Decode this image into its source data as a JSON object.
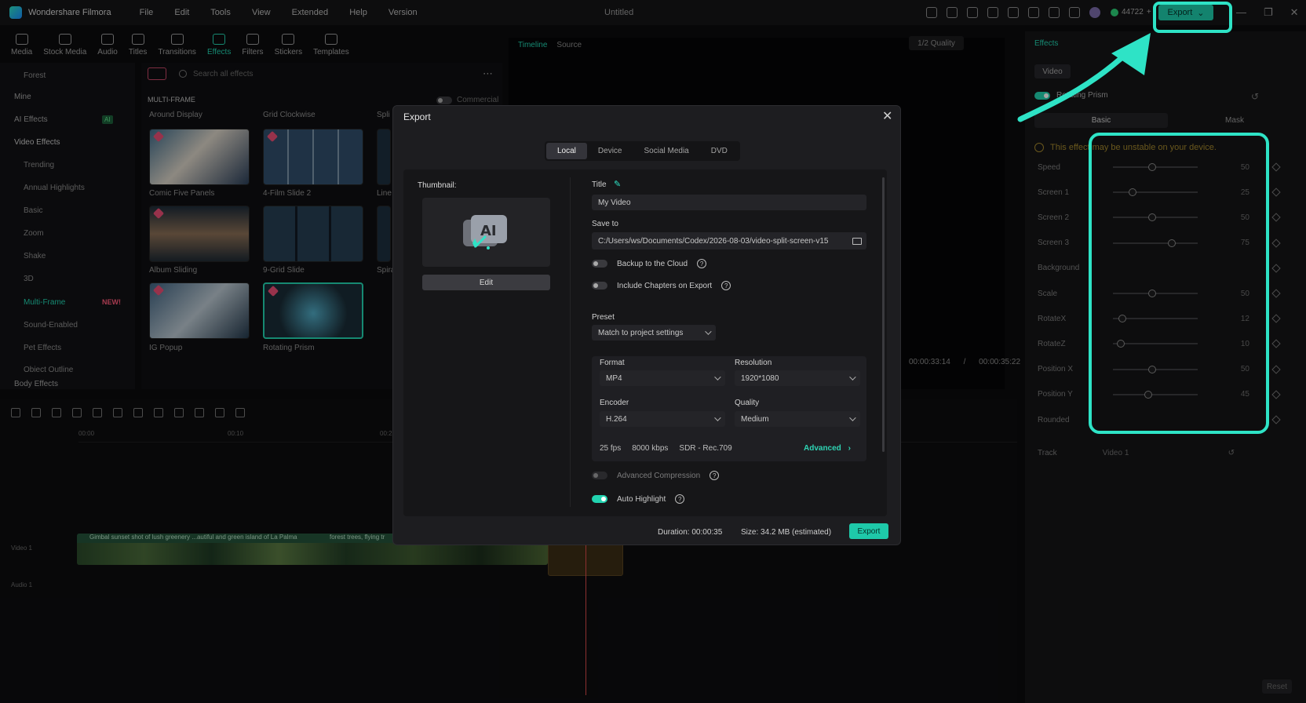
{
  "app": {
    "name": "Wondershare Filmora",
    "menu": [
      "File",
      "Edit",
      "Tools",
      "View",
      "Extended",
      "Help",
      "Version"
    ],
    "document_title": "Untitled",
    "credits": "44722",
    "export_label": "Export",
    "window_controls": [
      "—",
      "❐",
      "✕"
    ]
  },
  "toolbar": {
    "items": [
      {
        "label": "Media",
        "icon": "media-icon"
      },
      {
        "label": "Stock Media",
        "icon": "stock-media-icon"
      },
      {
        "label": "Audio",
        "icon": "audio-icon"
      },
      {
        "label": "Titles",
        "icon": "titles-icon"
      },
      {
        "label": "Transitions",
        "icon": "transitions-icon"
      },
      {
        "label": "Effects",
        "icon": "effects-icon",
        "active": true
      },
      {
        "label": "Filters",
        "icon": "filters-icon"
      },
      {
        "label": "Stickers",
        "icon": "stickers-icon"
      },
      {
        "label": "Templates",
        "icon": "templates-icon"
      }
    ]
  },
  "sidebar": {
    "items": [
      {
        "label": "Forest"
      },
      {
        "label": "Mine"
      },
      {
        "label": "AI Effects"
      },
      {
        "label": "Video Effects"
      },
      {
        "label": "Trending"
      },
      {
        "label": "Annual Highlights"
      },
      {
        "label": "Basic"
      },
      {
        "label": "Zoom"
      },
      {
        "label": "Shake"
      },
      {
        "label": "3D"
      },
      {
        "label": "Multi-Frame"
      },
      {
        "label": "Sound-Enabled"
      },
      {
        "label": "Pet Effects"
      },
      {
        "label": "Object Outline"
      },
      {
        "label": "Body Effects"
      }
    ],
    "ai_badge": "AI",
    "new_badge": "NEW!"
  },
  "effects": {
    "search_placeholder": "Search all effects",
    "commercial_label": "Commercial",
    "section": "MULTI-FRAME",
    "top_labels": [
      "Around Display",
      "Grid Clockwise",
      "Spli"
    ],
    "grid": [
      {
        "label": "Comic Five Panels"
      },
      {
        "label": "4-Film Slide 2"
      },
      {
        "label": "Line"
      },
      {
        "label": "Album Sliding"
      },
      {
        "label": "9-Grid Slide"
      },
      {
        "label": "Spira"
      },
      {
        "label": "IG Popup"
      },
      {
        "label": "Rotating Prism"
      }
    ]
  },
  "player": {
    "tabs": [
      "Timeline",
      "Source"
    ],
    "quality": "1/2 Quality",
    "current_time": "00:00:33:14",
    "separator": "/",
    "total_time": "00:00:35:22"
  },
  "timeline": {
    "ticks": [
      "00:00",
      "00:10",
      "00:2"
    ],
    "clip1_caption": "Gimbal sunset shot of lush greenery ...autiful and green island of La Palma",
    "clip2_caption": "forest trees, flying tr",
    "video_track": "Video 1",
    "audio_track": "Audio 1"
  },
  "right_panel": {
    "title": "Effects",
    "tab": "Video",
    "effect_name": "Rotating Prism",
    "subtabs": [
      "Basic",
      "Mask"
    ],
    "warning": "This effect may be unstable on your device.",
    "properties": [
      {
        "name": "Speed",
        "value": "50",
        "level": 0.5
      },
      {
        "name": "Screen 1",
        "value": "25",
        "level": 0.25
      },
      {
        "name": "Screen 2",
        "value": "50",
        "level": 0.5
      },
      {
        "name": "Screen 3",
        "value": "75",
        "level": 0.75
      },
      {
        "name": "Background",
        "value": "",
        "level": null
      },
      {
        "name": "Scale",
        "value": "50",
        "level": 0.5
      },
      {
        "name": "RotateX",
        "value": "12",
        "level": 0.12
      },
      {
        "name": "RotateZ",
        "value": "10",
        "level": 0.1
      },
      {
        "name": "Position X",
        "value": "50",
        "level": 0.5
      },
      {
        "name": "Position Y",
        "value": "45",
        "level": 0.45
      },
      {
        "name": "Rounded",
        "value": "",
        "level": null
      }
    ],
    "track_label": "Track",
    "track_value": "Video 1",
    "reset": "Reset"
  },
  "dialog": {
    "title": "Export",
    "close": "✕",
    "tabs": [
      "Local",
      "Device",
      "Social Media",
      "DVD"
    ],
    "active_tab": "Local",
    "thumbnail_label": "Thumbnail:",
    "edit_label": "Edit",
    "title_label": "Title",
    "title_value": "My Video",
    "save_to_label": "Save to",
    "save_to_value": "C:/Users/ws/Documents/Codex/2026-08-03/video-split-screen-v15",
    "backup_label": "Backup to the Cloud",
    "chapters_label": "Include Chapters on Export",
    "preset_label": "Preset",
    "preset_value": "Match to project settings",
    "format_label": "Format",
    "format_value": "MP4",
    "resolution_label": "Resolution",
    "resolution_value": "1920*1080",
    "encoder_label": "Encoder",
    "encoder_value": "H.264",
    "quality_label": "Quality",
    "quality_value": "Medium",
    "fps": "25 fps",
    "bitrate": "8000 kbps",
    "color": "SDR - Rec.709",
    "advanced_label": "Advanced",
    "advanced_compression_label": "Advanced Compression",
    "auto_highlight_label": "Auto Highlight",
    "duration": "Duration: 00:00:35",
    "size": "Size:  34.2 MB (estimated)",
    "export_button": "Export"
  },
  "colors": {
    "accent": "#1ec9a9",
    "annotation": "#2ee3c6",
    "warning": "#a3872d"
  }
}
